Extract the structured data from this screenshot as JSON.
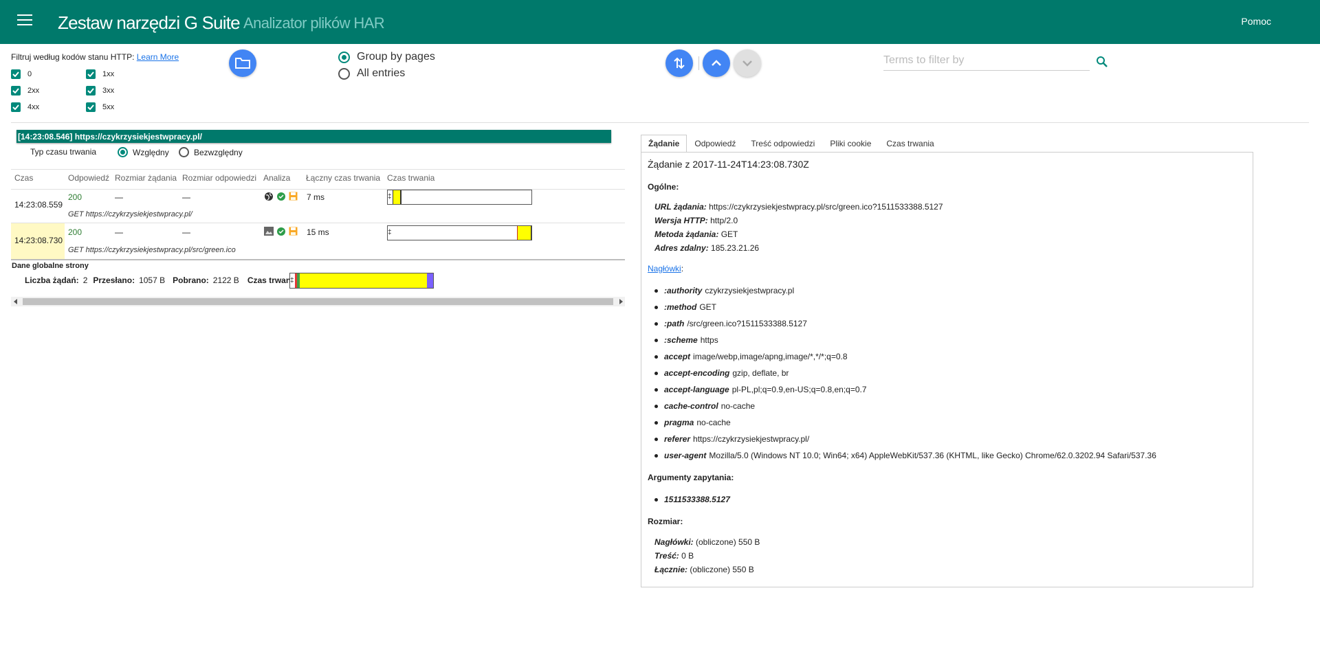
{
  "header": {
    "title": "Zestaw narzędzi G Suite",
    "subtitle": "Analizator plików HAR",
    "help": "Pomoc"
  },
  "filter": {
    "label": "Filtruj według kodów stanu HTTP: ",
    "learn_more": "Learn More",
    "codes": [
      "0",
      "1xx",
      "2xx",
      "3xx",
      "4xx",
      "5xx"
    ]
  },
  "grouping": {
    "pages": "Group by pages",
    "entries": "All entries",
    "selected": "pages"
  },
  "search": {
    "placeholder": "Terms to filter by"
  },
  "page": {
    "header": "[14:23:08.546] https://czykrzysiekjestwpracy.pl/",
    "timing_type_label": "Typ czasu trwania",
    "timing_relative": "Względny",
    "timing_absolute": "Bezwzględny",
    "columns": [
      "Czas",
      "Odpowiedź",
      "Rozmiar żądania",
      "Rozmiar odpowiedzi",
      "Analiza",
      "Łączny czas trwania",
      "Czas trwania"
    ],
    "rows": [
      {
        "time": "14:23:08.559",
        "status": "200",
        "req_size": "—",
        "res_size": "—",
        "total": "7 ms",
        "url": "GET https://czykrzysiekjestwpracy.pl/"
      },
      {
        "time": "14:23:08.730",
        "status": "200",
        "req_size": "—",
        "res_size": "—",
        "total": "15 ms",
        "url": "GET https://czykrzysiekjestwpracy.pl/src/green.ico"
      }
    ],
    "global": {
      "title": "Dane globalne strony",
      "count_label": "Liczba żądań:",
      "count": "2",
      "sent_label": "Przesłano:",
      "sent": "1057 B",
      "received_label": "Pobrano:",
      "received": "2122 B",
      "duration_label": "Czas trwania:"
    }
  },
  "detail": {
    "tabs": [
      "Żądanie",
      "Odpowiedź",
      "Treść odpowiedzi",
      "Pliki cookie",
      "Czas trwania"
    ],
    "title": "Żądanie z 2017-11-24T14:23:08.730Z",
    "general_label": "Ogólne:",
    "general": [
      {
        "key": "URL żądania:",
        "value": " https://czykrzysiekjestwpracy.pl/src/green.ico?1511533388.5127"
      },
      {
        "key": "Wersja HTTP:",
        "value": " http/2.0"
      },
      {
        "key": "Metoda żądania:",
        "value": " GET"
      },
      {
        "key": "Adres zdalny:",
        "value": " 185.23.21.26"
      }
    ],
    "headers_label": "Nagłówki",
    "headers": [
      {
        "key": ":authority",
        "value": "czykrzysiekjestwpracy.pl"
      },
      {
        "key": ":method",
        "value": "GET"
      },
      {
        "key": ":path",
        "value": "/src/green.ico?1511533388.5127"
      },
      {
        "key": ":scheme",
        "value": "https"
      },
      {
        "key": "accept",
        "value": "image/webp,image/apng,image/*,*/*;q=0.8"
      },
      {
        "key": "accept-encoding",
        "value": "gzip, deflate, br"
      },
      {
        "key": "accept-language",
        "value": "pl-PL,pl;q=0.9,en-US;q=0.8,en;q=0.7"
      },
      {
        "key": "cache-control",
        "value": "no-cache"
      },
      {
        "key": "pragma",
        "value": "no-cache"
      },
      {
        "key": "referer",
        "value": "https://czykrzysiekjestwpracy.pl/"
      },
      {
        "key": "user-agent",
        "value": "Mozilla/5.0 (Windows NT 10.0; Win64; x64) AppleWebKit/537.36 (KHTML, like Gecko) Chrome/62.0.3202.94 Safari/537.36"
      }
    ],
    "query_label": "Argumenty zapytania:",
    "query": [
      "1511533388.5127"
    ],
    "size_label": "Rozmiar:",
    "sizes": [
      {
        "key": "Nagłówki:",
        "value": " (obliczone)   550 B"
      },
      {
        "key": "Treść:",
        "value": " 0 B"
      },
      {
        "key": "Łącznie:",
        "value": " (obliczone)   550 B"
      }
    ]
  },
  "colors": {
    "primary": "#00796b",
    "accent": "#00897b",
    "blue_button": "#4285f4",
    "bar_yellow": "#ffff00",
    "bar_purple": "#7b61ff"
  }
}
